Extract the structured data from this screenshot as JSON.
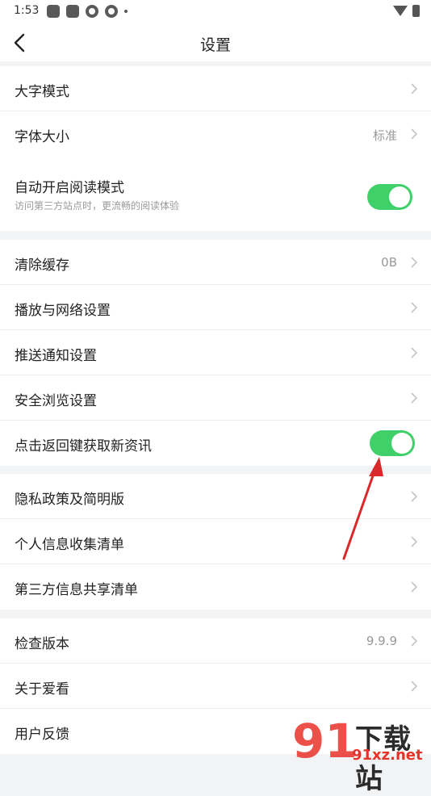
{
  "status_bar": {
    "time": "1:53",
    "icons": [
      "square-icon",
      "square-icon",
      "aperture-icon",
      "aperture-icon",
      "dot-icon",
      "wifi-icon",
      "battery-icon"
    ]
  },
  "header": {
    "title": "设置",
    "back_icon": "chevron-left-icon"
  },
  "groups": {
    "display": {
      "large_font_mode": "大字模式",
      "font_size": {
        "label": "字体大小",
        "value": "标准"
      }
    },
    "reading": {
      "auto_reading": {
        "label": "自动开启阅读模式",
        "subtitle": "访问第三方站点时，更流畅的阅读体验",
        "enabled": true
      }
    },
    "general": {
      "clear_cache": {
        "label": "清除缓存",
        "value": "0B"
      },
      "playback_network": "播放与网络设置",
      "push_notifications": "推送通知设置",
      "safe_browsing": "安全浏览设置",
      "back_key_refresh": {
        "label": "点击返回键获取新资讯",
        "enabled": true
      }
    },
    "privacy": {
      "privacy_policy": "隐私政策及简明版",
      "personal_info_list": "个人信息收集清单",
      "third_party_sharing": "第三方信息共享清单"
    },
    "about": {
      "check_version": {
        "label": "检查版本",
        "value": "9.9.9"
      },
      "about_app": "关于爱看",
      "feedback": "用户反馈"
    }
  },
  "watermark": {
    "logo_digits": "91",
    "title": "下载站",
    "domain": "91xz.net"
  },
  "colors": {
    "toggle_on": "#3fd06a",
    "annotation_arrow": "#d9292a",
    "background": "#f2f3f5"
  }
}
